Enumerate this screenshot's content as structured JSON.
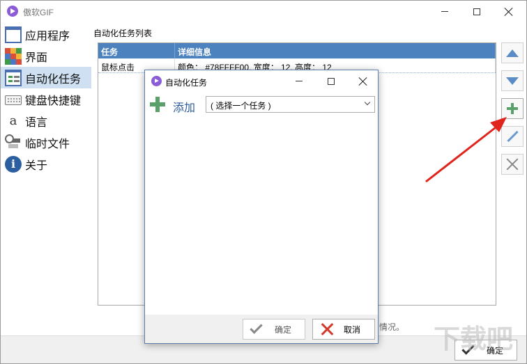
{
  "window": {
    "title": "傲软GIF",
    "minimize_label": "—",
    "maximize_label": "☐",
    "close_label": "✕"
  },
  "sidebar": {
    "items": [
      {
        "label": "应用程序",
        "icon": "app-window-icon",
        "active": false
      },
      {
        "label": "界面",
        "icon": "palette-grid-icon",
        "active": false
      },
      {
        "label": "自动化任务",
        "icon": "task-list-icon",
        "active": true
      },
      {
        "label": "键盘快捷键",
        "icon": "keyboard-icon",
        "active": false
      },
      {
        "label": "语言",
        "icon": "language-icon",
        "active": false
      },
      {
        "label": "临时文件",
        "icon": "temp-files-icon",
        "active": false
      },
      {
        "label": "关于",
        "icon": "info-icon",
        "active": false
      }
    ]
  },
  "main": {
    "section_title": "自动化任务列表",
    "list": {
      "columns": [
        "任务",
        "详细信息"
      ],
      "rows": [
        {
          "task": "鼠标点击",
          "details": "颜色： #78FFFF00, 宽度： 12, 高度： 12"
        }
      ]
    },
    "status_text": "情况。",
    "ok_label": "确定"
  },
  "toolbar": {
    "buttons": [
      "move-up",
      "move-down",
      "add",
      "edit",
      "delete"
    ]
  },
  "dialog": {
    "title": "自动化任务",
    "add_label": "添加",
    "select_value": "( 选择一个任务 )",
    "ok_label": "确定",
    "cancel_label": "取消"
  },
  "colors": {
    "list_header": "#4C83BF",
    "sidebar_active": "#CFE0F3",
    "accent_green": "#5AA06A",
    "arrow_red": "#E0241C"
  },
  "watermark": {
    "text": "下载吧"
  }
}
